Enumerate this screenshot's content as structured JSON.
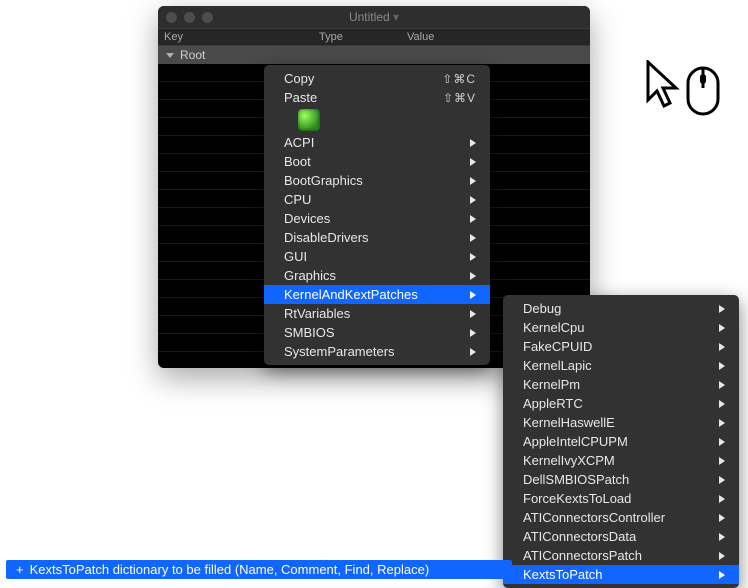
{
  "window": {
    "title": "Untitled",
    "headers": {
      "key": "Key",
      "type": "Type",
      "value": "Value"
    },
    "root": {
      "key": "Root",
      "type": "",
      "value": ""
    }
  },
  "menu1": {
    "copy": {
      "label": "Copy",
      "shortcut": "⇧⌘C"
    },
    "paste": {
      "label": "Paste",
      "shortcut": "⇧⌘V"
    },
    "items": [
      "ACPI",
      "Boot",
      "BootGraphics",
      "CPU",
      "Devices",
      "DisableDrivers",
      "GUI",
      "Graphics",
      "KernelAndKextPatches",
      "RtVariables",
      "SMBIOS",
      "SystemParameters"
    ],
    "selected": "KernelAndKextPatches"
  },
  "menu2": {
    "items": [
      "Debug",
      "KernelCpu",
      "FakeCPUID",
      "KernelLapic",
      "KernelPm",
      "AppleRTC",
      "KernelHaswellE",
      "AppleIntelCPUPM",
      "KernelIvyXCPM",
      "DellSMBIOSPatch",
      "ForceKextsToLoad",
      "ATIConnectorsController",
      "ATIConnectorsData",
      "ATIConnectorsPatch",
      "KextsToPatch"
    ],
    "selected": "KextsToPatch"
  },
  "statusbar": {
    "plus": "+",
    "text": "KextsToPatch dictionary to be filled (Name, Comment, Find, Replace)"
  }
}
